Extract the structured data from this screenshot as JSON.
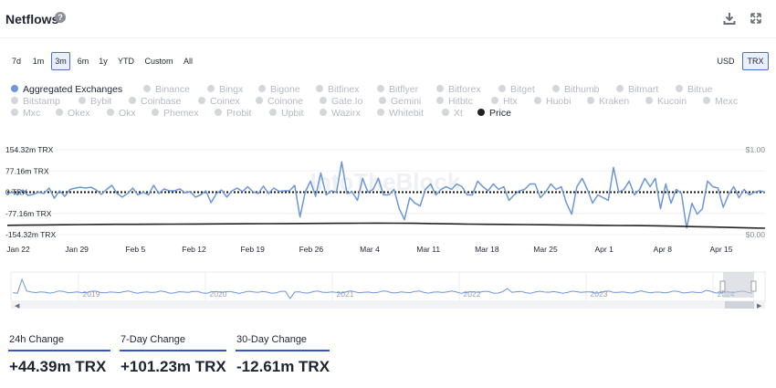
{
  "header": {
    "title": "Netflows",
    "help_icon": "?"
  },
  "ranges": [
    {
      "label": "7d",
      "active": false
    },
    {
      "label": "1m",
      "active": false
    },
    {
      "label": "3m",
      "active": true
    },
    {
      "label": "6m",
      "active": false
    },
    {
      "label": "1y",
      "active": false
    },
    {
      "label": "YTD",
      "active": false
    },
    {
      "label": "Custom",
      "active": false
    },
    {
      "label": "All",
      "active": false
    }
  ],
  "currency": [
    {
      "label": "USD",
      "active": false
    },
    {
      "label": "TRX",
      "active": true
    }
  ],
  "legend": [
    {
      "label": "Aggregated Exchanges",
      "state": "agg"
    },
    {
      "label": "Binance"
    },
    {
      "label": "Bingx"
    },
    {
      "label": "Bigone"
    },
    {
      "label": "Bitfinex"
    },
    {
      "label": "Bitflyer"
    },
    {
      "label": "Bitforex"
    },
    {
      "label": "Bitget"
    },
    {
      "label": "Bithumb"
    },
    {
      "label": "Bitmart"
    },
    {
      "label": "Bitrue"
    },
    {
      "label": "Bitstamp"
    },
    {
      "label": "Bybit"
    },
    {
      "label": "Coinbase"
    },
    {
      "label": "Coinex"
    },
    {
      "label": "Coinone"
    },
    {
      "label": "Gate.Io"
    },
    {
      "label": "Gemini"
    },
    {
      "label": "Hitbtc"
    },
    {
      "label": "Htx"
    },
    {
      "label": "Huobi"
    },
    {
      "label": "Kraken"
    },
    {
      "label": "Kucoin"
    },
    {
      "label": "Mexc"
    },
    {
      "label": "Mxc"
    },
    {
      "label": "Okex"
    },
    {
      "label": "Okx"
    },
    {
      "label": "Phemex"
    },
    {
      "label": "Probit"
    },
    {
      "label": "Upbit"
    },
    {
      "label": "Wazirx"
    },
    {
      "label": "Whitebit"
    },
    {
      "label": "Xt"
    },
    {
      "label": "Price",
      "state": "price"
    }
  ],
  "watermark": "IntoTheBlock",
  "chart_data": {
    "type": "line",
    "y_ticks": [
      "154.32m TRX",
      "77.16m TRX",
      "0 TRX",
      "-77.16m TRX",
      "-154.32m TRX"
    ],
    "y_tick_values": [
      154.32,
      77.16,
      0,
      -77.16,
      -154.32
    ],
    "y2_ticks": [
      "$1.00",
      "$0.00"
    ],
    "y2_tick_values": [
      1.0,
      0.0
    ],
    "x_ticks": [
      "Jan 22",
      "Jan 29",
      "Feb 5",
      "Feb 12",
      "Feb 19",
      "Feb 26",
      "Mar 4",
      "Mar 11",
      "Mar 18",
      "Mar 25",
      "Apr 1",
      "Apr 8",
      "Apr 15"
    ],
    "ylim": [
      -154.32,
      154.32
    ],
    "y2lim": [
      0,
      1
    ],
    "grid": true,
    "zero_line": "dotted",
    "series": [
      {
        "name": "Aggregated Exchanges",
        "color": "#6c96d8",
        "unit": "m TRX",
        "values": [
          -5,
          0,
          -10,
          8,
          -12,
          -8,
          0,
          -5,
          15,
          -22,
          5,
          -15,
          10,
          15,
          18,
          15,
          18,
          8,
          -8,
          10,
          25,
          -5,
          -18,
          -5,
          15,
          -10,
          0,
          -10,
          25,
          -5,
          12,
          5,
          5,
          12,
          -2,
          2,
          -18,
          -10,
          5,
          -38,
          -5,
          8,
          -18,
          5,
          15,
          2,
          20,
          2,
          -5,
          22,
          -5,
          15,
          3,
          5,
          5,
          25,
          -90,
          0,
          40,
          -15,
          70,
          -10,
          5,
          0,
          110,
          -5,
          0,
          -30,
          50,
          0,
          10,
          50,
          -10,
          -10,
          10,
          -60,
          -100,
          -20,
          -40,
          -50,
          10,
          30,
          -10,
          10,
          20,
          10,
          30,
          20,
          -10,
          -10,
          40,
          20,
          5,
          30,
          10,
          20,
          -30,
          -10,
          5,
          10,
          30,
          30,
          -20,
          0,
          30,
          10,
          20,
          -40,
          -80,
          20,
          50,
          10,
          -40,
          -10,
          -20,
          -30,
          90,
          0,
          10,
          40,
          -10,
          10,
          50,
          20,
          50,
          -60,
          30,
          -40,
          10,
          -5,
          -130,
          -40,
          -80,
          -60,
          40,
          20,
          15,
          -55,
          -10,
          20,
          -20,
          10,
          -10,
          0,
          5,
          0
        ]
      },
      {
        "name": "Price",
        "color": "#222222",
        "unit": "$",
        "values": [
          0.11,
          0.112,
          0.114,
          0.116,
          0.118,
          0.12,
          0.121,
          0.122,
          0.123,
          0.124,
          0.125,
          0.126,
          0.127,
          0.128,
          0.129,
          0.13,
          0.131,
          0.132,
          0.133,
          0.134,
          0.135,
          0.134,
          0.133,
          0.13,
          0.127,
          0.124,
          0.122,
          0.12,
          0.118,
          0.116,
          0.114,
          0.112,
          0.11,
          0.108,
          0.106,
          0.104,
          0.1,
          0.095,
          0.09,
          0.085,
          0.08,
          0.075
        ]
      }
    ]
  },
  "navigator": {
    "years": [
      "2019",
      "2020",
      "2021",
      "2022",
      "2023",
      "2024"
    ]
  },
  "stats": [
    {
      "label": "24h Change",
      "value": "+44.39m TRX"
    },
    {
      "label": "7-Day Change",
      "value": "+101.23m TRX"
    },
    {
      "label": "30-Day Change",
      "value": "-12.61m TRX"
    }
  ]
}
